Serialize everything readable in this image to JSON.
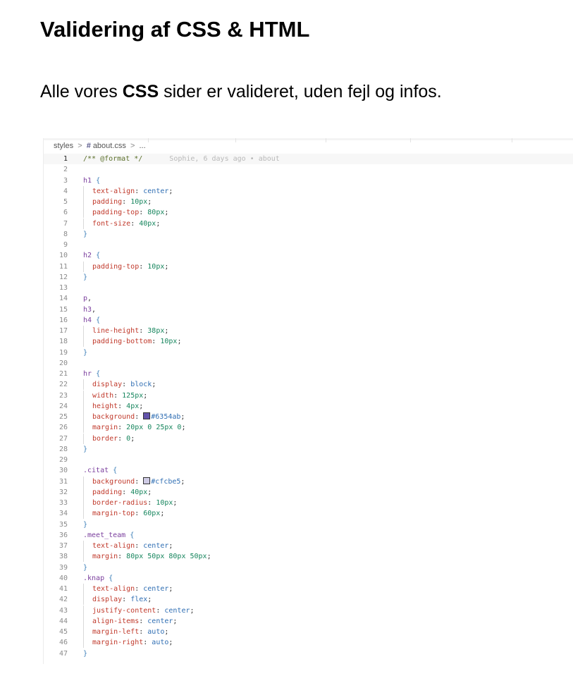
{
  "heading": "Validering af CSS & HTML",
  "intro": {
    "before": "Alle vores ",
    "bold": "CSS",
    "after": " sider er valideret, uden fejl og infos."
  },
  "editor": {
    "breadcrumb": {
      "folder": "styles",
      "sep": ">",
      "hash": "#",
      "file": "about.css",
      "more": "..."
    },
    "blame": "Sophie, 6 days ago • about",
    "current_line": 1,
    "last_line_number": 47,
    "colors": {
      "#6354ab": "#6354ab",
      "#cfcbe5": "#cfcbe5"
    },
    "lines": [
      {
        "n": "1",
        "parts": [
          {
            "t": "/** @format */",
            "c": "cmt"
          }
        ]
      },
      {
        "n": "2",
        "parts": []
      },
      {
        "n": "3",
        "parts": [
          {
            "t": "h1 ",
            "c": "sel"
          },
          {
            "t": "{",
            "c": "brace"
          }
        ]
      },
      {
        "n": "4",
        "indent": true,
        "parts": [
          {
            "t": "text-align",
            "c": "prop"
          },
          {
            "t": ": ",
            "c": "punct"
          },
          {
            "t": "center",
            "c": "kw"
          },
          {
            "t": ";",
            "c": "punct"
          }
        ]
      },
      {
        "n": "5",
        "indent": true,
        "parts": [
          {
            "t": "padding",
            "c": "prop"
          },
          {
            "t": ": ",
            "c": "punct"
          },
          {
            "t": "10px",
            "c": "val"
          },
          {
            "t": ";",
            "c": "punct"
          }
        ]
      },
      {
        "n": "6",
        "indent": true,
        "parts": [
          {
            "t": "padding-top",
            "c": "prop"
          },
          {
            "t": ": ",
            "c": "punct"
          },
          {
            "t": "80px",
            "c": "val"
          },
          {
            "t": ";",
            "c": "punct"
          }
        ]
      },
      {
        "n": "7",
        "indent": true,
        "parts": [
          {
            "t": "font-size",
            "c": "prop"
          },
          {
            "t": ": ",
            "c": "punct"
          },
          {
            "t": "40px",
            "c": "val"
          },
          {
            "t": ";",
            "c": "punct"
          }
        ]
      },
      {
        "n": "8",
        "parts": [
          {
            "t": "}",
            "c": "brace"
          }
        ]
      },
      {
        "n": "9",
        "parts": []
      },
      {
        "n": "10",
        "parts": [
          {
            "t": "h2 ",
            "c": "sel"
          },
          {
            "t": "{",
            "c": "brace"
          }
        ]
      },
      {
        "n": "11",
        "indent": true,
        "parts": [
          {
            "t": "padding-top",
            "c": "prop"
          },
          {
            "t": ": ",
            "c": "punct"
          },
          {
            "t": "10px",
            "c": "val"
          },
          {
            "t": ";",
            "c": "punct"
          }
        ]
      },
      {
        "n": "12",
        "parts": [
          {
            "t": "}",
            "c": "brace"
          }
        ]
      },
      {
        "n": "13",
        "parts": []
      },
      {
        "n": "14",
        "parts": [
          {
            "t": "p",
            "c": "sel"
          },
          {
            "t": ",",
            "c": "punct"
          }
        ]
      },
      {
        "n": "15",
        "parts": [
          {
            "t": "h3",
            "c": "sel"
          },
          {
            "t": ",",
            "c": "punct"
          }
        ]
      },
      {
        "n": "16",
        "parts": [
          {
            "t": "h4 ",
            "c": "sel"
          },
          {
            "t": "{",
            "c": "brace"
          }
        ]
      },
      {
        "n": "17",
        "indent": true,
        "parts": [
          {
            "t": "line-height",
            "c": "prop"
          },
          {
            "t": ": ",
            "c": "punct"
          },
          {
            "t": "38px",
            "c": "val"
          },
          {
            "t": ";",
            "c": "punct"
          }
        ]
      },
      {
        "n": "18",
        "indent": true,
        "parts": [
          {
            "t": "padding-bottom",
            "c": "prop"
          },
          {
            "t": ": ",
            "c": "punct"
          },
          {
            "t": "10px",
            "c": "val"
          },
          {
            "t": ";",
            "c": "punct"
          }
        ]
      },
      {
        "n": "19",
        "parts": [
          {
            "t": "}",
            "c": "brace"
          }
        ]
      },
      {
        "n": "20",
        "parts": []
      },
      {
        "n": "21",
        "parts": [
          {
            "t": "hr ",
            "c": "sel"
          },
          {
            "t": "{",
            "c": "brace"
          }
        ]
      },
      {
        "n": "22",
        "indent": true,
        "parts": [
          {
            "t": "display",
            "c": "prop"
          },
          {
            "t": ": ",
            "c": "punct"
          },
          {
            "t": "block",
            "c": "kw"
          },
          {
            "t": ";",
            "c": "punct"
          }
        ]
      },
      {
        "n": "23",
        "indent": true,
        "parts": [
          {
            "t": "width",
            "c": "prop"
          },
          {
            "t": ": ",
            "c": "punct"
          },
          {
            "t": "125px",
            "c": "val"
          },
          {
            "t": ";",
            "c": "punct"
          }
        ]
      },
      {
        "n": "24",
        "indent": true,
        "parts": [
          {
            "t": "height",
            "c": "prop"
          },
          {
            "t": ": ",
            "c": "punct"
          },
          {
            "t": "4px",
            "c": "val"
          },
          {
            "t": ";",
            "c": "punct"
          }
        ]
      },
      {
        "n": "25",
        "indent": true,
        "parts": [
          {
            "t": "background",
            "c": "prop"
          },
          {
            "t": ": ",
            "c": "punct"
          },
          {
            "swatch": "purple"
          },
          {
            "t": "#6354ab",
            "c": "kw"
          },
          {
            "t": ";",
            "c": "punct"
          }
        ]
      },
      {
        "n": "26",
        "indent": true,
        "parts": [
          {
            "t": "margin",
            "c": "prop"
          },
          {
            "t": ": ",
            "c": "punct"
          },
          {
            "t": "20px 0 25px 0",
            "c": "val"
          },
          {
            "t": ";",
            "c": "punct"
          }
        ]
      },
      {
        "n": "27",
        "indent": true,
        "parts": [
          {
            "t": "border",
            "c": "prop"
          },
          {
            "t": ": ",
            "c": "punct"
          },
          {
            "t": "0",
            "c": "val"
          },
          {
            "t": ";",
            "c": "punct"
          }
        ]
      },
      {
        "n": "28",
        "parts": [
          {
            "t": "}",
            "c": "brace"
          }
        ]
      },
      {
        "n": "29",
        "parts": []
      },
      {
        "n": "30",
        "parts": [
          {
            "t": ".citat ",
            "c": "sel"
          },
          {
            "t": "{",
            "c": "brace"
          }
        ]
      },
      {
        "n": "31",
        "indent": true,
        "parts": [
          {
            "t": "background",
            "c": "prop"
          },
          {
            "t": ": ",
            "c": "punct"
          },
          {
            "swatch": "grey"
          },
          {
            "t": "#cfcbe5",
            "c": "kw"
          },
          {
            "t": ";",
            "c": "punct"
          }
        ]
      },
      {
        "n": "32",
        "indent": true,
        "parts": [
          {
            "t": "padding",
            "c": "prop"
          },
          {
            "t": ": ",
            "c": "punct"
          },
          {
            "t": "40px",
            "c": "val"
          },
          {
            "t": ";",
            "c": "punct"
          }
        ]
      },
      {
        "n": "33",
        "indent": true,
        "parts": [
          {
            "t": "border-radius",
            "c": "prop"
          },
          {
            "t": ": ",
            "c": "punct"
          },
          {
            "t": "10px",
            "c": "val"
          },
          {
            "t": ";",
            "c": "punct"
          }
        ]
      },
      {
        "n": "34",
        "indent": true,
        "parts": [
          {
            "t": "margin-top",
            "c": "prop"
          },
          {
            "t": ": ",
            "c": "punct"
          },
          {
            "t": "60px",
            "c": "val"
          },
          {
            "t": ";",
            "c": "punct"
          }
        ]
      },
      {
        "n": "35",
        "parts": [
          {
            "t": "}",
            "c": "brace"
          }
        ]
      },
      {
        "n": "36",
        "parts": [
          {
            "t": ".meet_team ",
            "c": "sel"
          },
          {
            "t": "{",
            "c": "brace"
          }
        ]
      },
      {
        "n": "37",
        "indent": true,
        "parts": [
          {
            "t": "text-align",
            "c": "prop"
          },
          {
            "t": ": ",
            "c": "punct"
          },
          {
            "t": "center",
            "c": "kw"
          },
          {
            "t": ";",
            "c": "punct"
          }
        ]
      },
      {
        "n": "38",
        "indent": true,
        "parts": [
          {
            "t": "margin",
            "c": "prop"
          },
          {
            "t": ": ",
            "c": "punct"
          },
          {
            "t": "80px 50px 80px 50px",
            "c": "val"
          },
          {
            "t": ";",
            "c": "punct"
          }
        ]
      },
      {
        "n": "39",
        "parts": [
          {
            "t": "}",
            "c": "brace"
          }
        ]
      },
      {
        "n": "40",
        "parts": [
          {
            "t": ".knap ",
            "c": "sel"
          },
          {
            "t": "{",
            "c": "brace"
          }
        ]
      },
      {
        "n": "41",
        "indent": true,
        "parts": [
          {
            "t": "text-align",
            "c": "prop"
          },
          {
            "t": ": ",
            "c": "punct"
          },
          {
            "t": "center",
            "c": "kw"
          },
          {
            "t": ";",
            "c": "punct"
          }
        ]
      },
      {
        "n": "42",
        "indent": true,
        "parts": [
          {
            "t": "display",
            "c": "prop"
          },
          {
            "t": ": ",
            "c": "punct"
          },
          {
            "t": "flex",
            "c": "kw"
          },
          {
            "t": ";",
            "c": "punct"
          }
        ]
      },
      {
        "n": "43",
        "indent": true,
        "parts": [
          {
            "t": "justify-content",
            "c": "prop"
          },
          {
            "t": ": ",
            "c": "punct"
          },
          {
            "t": "center",
            "c": "kw"
          },
          {
            "t": ";",
            "c": "punct"
          }
        ]
      },
      {
        "n": "44",
        "indent": true,
        "parts": [
          {
            "t": "align-items",
            "c": "prop"
          },
          {
            "t": ": ",
            "c": "punct"
          },
          {
            "t": "center",
            "c": "kw"
          },
          {
            "t": ";",
            "c": "punct"
          }
        ]
      },
      {
        "n": "45",
        "indent": true,
        "parts": [
          {
            "t": "margin-left",
            "c": "prop"
          },
          {
            "t": ": ",
            "c": "punct"
          },
          {
            "t": "auto",
            "c": "kw"
          },
          {
            "t": ";",
            "c": "punct"
          }
        ]
      },
      {
        "n": "46",
        "indent": true,
        "parts": [
          {
            "t": "margin-right",
            "c": "prop"
          },
          {
            "t": ": ",
            "c": "punct"
          },
          {
            "t": "auto",
            "c": "kw"
          },
          {
            "t": ";",
            "c": "punct"
          }
        ]
      },
      {
        "n": "47",
        "parts": [
          {
            "t": "}",
            "c": "brace"
          }
        ]
      }
    ]
  }
}
